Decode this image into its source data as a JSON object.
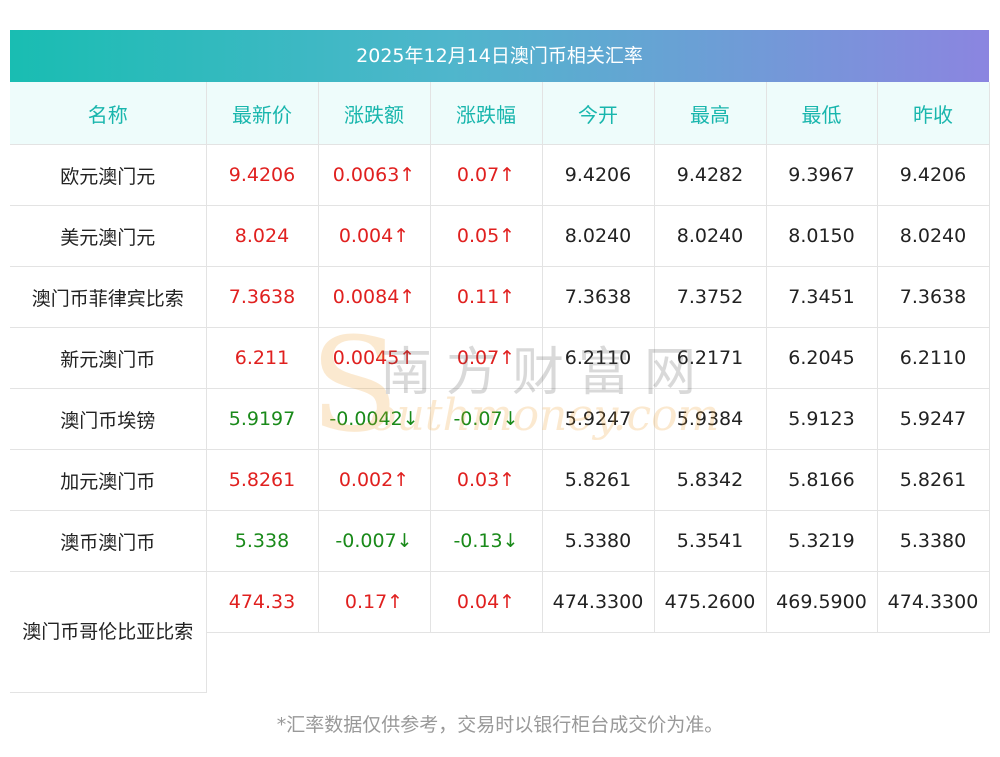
{
  "title": "2025年12月14日澳门币相关汇率",
  "columns": [
    "名称",
    "最新价",
    "涨跌额",
    "涨跌幅",
    "今开",
    "最高",
    "最低",
    "昨收"
  ],
  "rows": [
    {
      "name": "欧元澳门元",
      "latest": "9.4206",
      "change": "0.0063↑",
      "pct": "0.07↑",
      "open": "9.4206",
      "high": "9.4282",
      "low": "9.3967",
      "prev": "9.4206",
      "dir": "up"
    },
    {
      "name": "美元澳门元",
      "latest": "8.024",
      "change": "0.004↑",
      "pct": "0.05↑",
      "open": "8.0240",
      "high": "8.0240",
      "low": "8.0150",
      "prev": "8.0240",
      "dir": "up"
    },
    {
      "name": "澳门币菲律宾比索",
      "latest": "7.3638",
      "change": "0.0084↑",
      "pct": "0.11↑",
      "open": "7.3638",
      "high": "7.3752",
      "low": "7.3451",
      "prev": "7.3638",
      "dir": "up"
    },
    {
      "name": "新元澳门币",
      "latest": "6.211",
      "change": "0.0045↑",
      "pct": "0.07↑",
      "open": "6.2110",
      "high": "6.2171",
      "low": "6.2045",
      "prev": "6.2110",
      "dir": "up"
    },
    {
      "name": "澳门币埃镑",
      "latest": "5.9197",
      "change": "-0.0042↓",
      "pct": "-0.07↓",
      "open": "5.9247",
      "high": "5.9384",
      "low": "5.9123",
      "prev": "5.9247",
      "dir": "down"
    },
    {
      "name": "加元澳门币",
      "latest": "5.8261",
      "change": "0.002↑",
      "pct": "0.03↑",
      "open": "5.8261",
      "high": "5.8342",
      "low": "5.8166",
      "prev": "5.8261",
      "dir": "up"
    },
    {
      "name": "澳币澳门币",
      "latest": "5.338",
      "change": "-0.007↓",
      "pct": "-0.13↓",
      "open": "5.3380",
      "high": "5.3541",
      "low": "5.3219",
      "prev": "5.3380",
      "dir": "down"
    },
    {
      "name": "澳门币哥伦比亚比索",
      "latest": "474.33",
      "change": "0.17↑",
      "pct": "0.04↑",
      "open": "474.3300",
      "high": "475.2600",
      "low": "469.5900",
      "prev": "474.3300",
      "dir": "up"
    }
  ],
  "footer_note": "*汇率数据仅供参考，交易时以银行柜台成交价为准。",
  "watermark": {
    "cn": "南方财富网",
    "en": "outhmoney.com",
    "s": "S"
  },
  "colors": {
    "up": "#e0201f",
    "down": "#1a8a1a",
    "header_text": "#19b6ad",
    "title_start": "#19bdb2",
    "title_end": "#8b85e0"
  }
}
